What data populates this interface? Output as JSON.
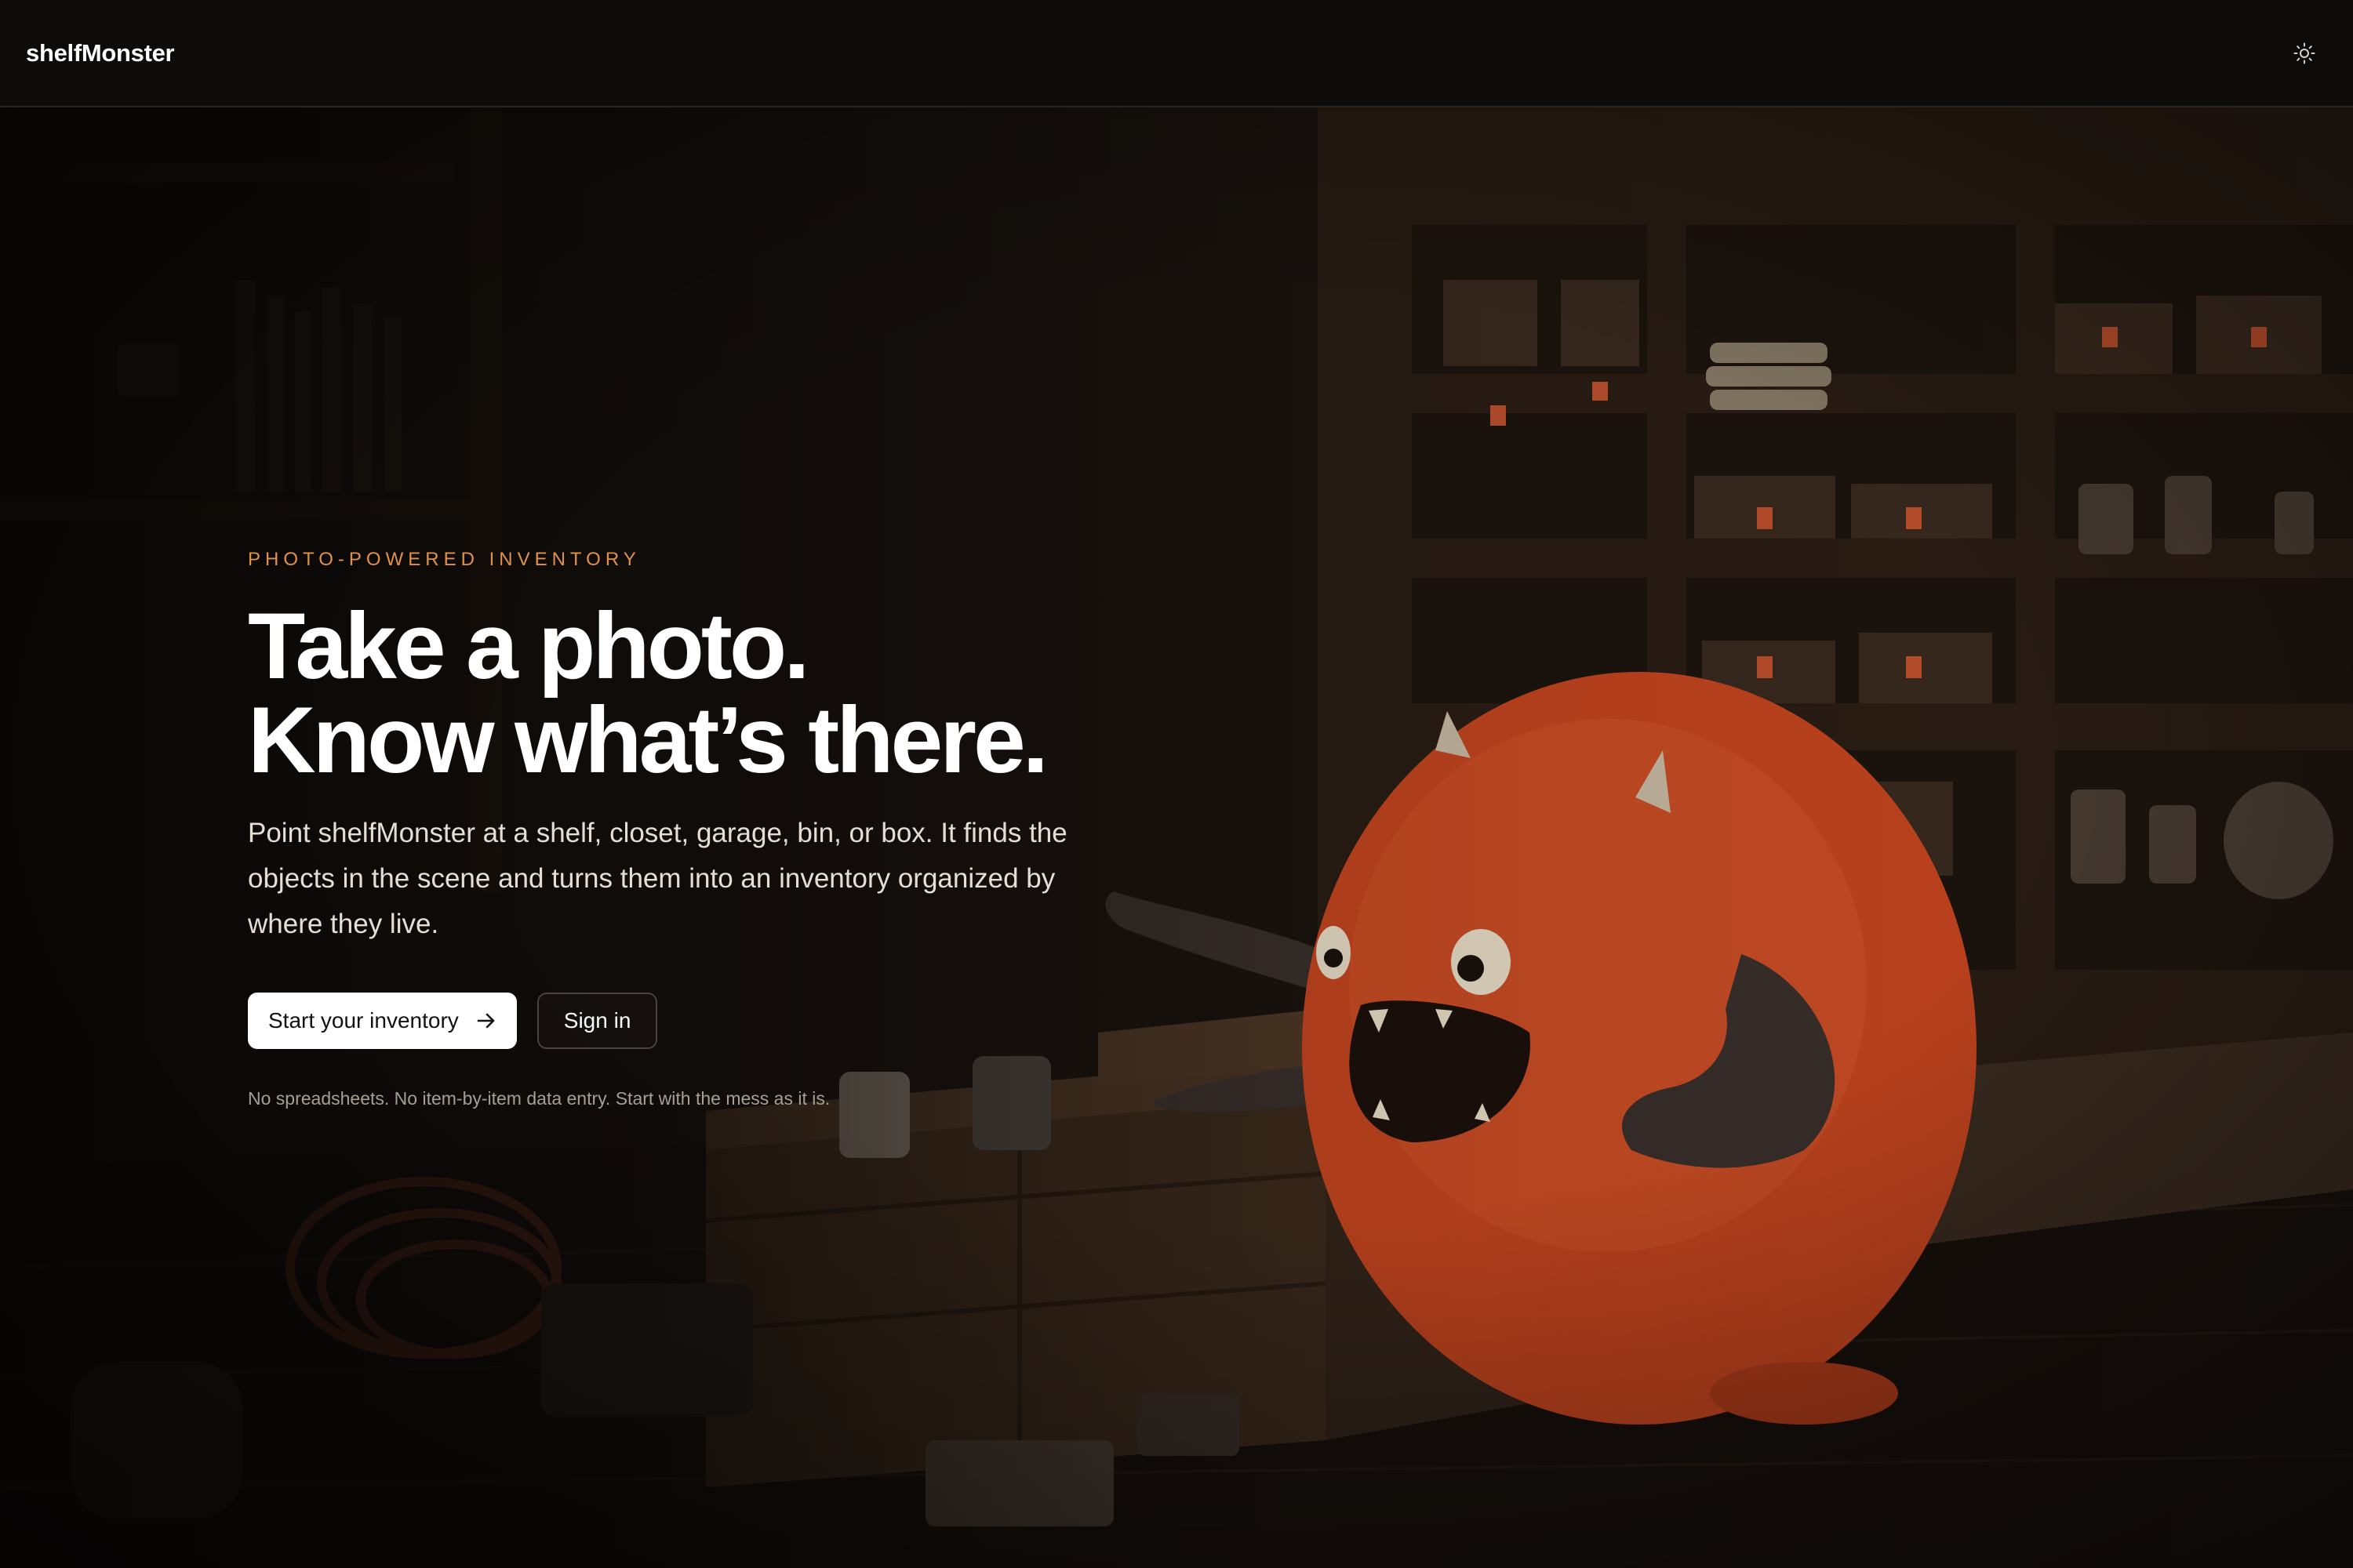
{
  "header": {
    "brand": "shelfMonster",
    "theme_toggle_icon": "sun-icon"
  },
  "hero": {
    "eyebrow": "PHOTO-POWERED INVENTORY",
    "headline_line1": "Take a photo.",
    "headline_line2": "Know what’s there.",
    "description": "Point shelfMonster at a shelf, closet, garage, bin, or box. It finds the objects in the scene and turns them into an inventory organized by where they live.",
    "primary_cta": {
      "label": "Start your inventory",
      "icon": "arrow-right-icon"
    },
    "secondary_cta": {
      "label": "Sign in"
    },
    "footnote": "No spreadsheets. No item-by-item data entry. Start with the mess as it is."
  },
  "colors": {
    "accent": "#e0924a",
    "background": "#0e0c0a",
    "monster": "#c9461f",
    "primary_button_bg": "#ffffff"
  }
}
